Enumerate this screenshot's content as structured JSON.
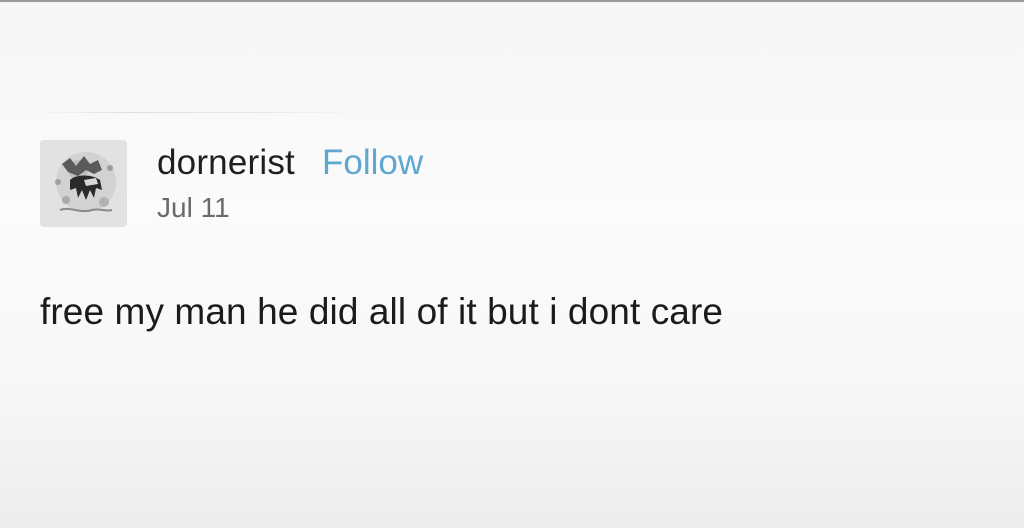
{
  "post": {
    "avatar_icon": "dark-creature-avatar",
    "username": "dornerist",
    "follow_label": "Follow",
    "date": "Jul 11",
    "text": "free my man he did all of it but i dont care"
  },
  "colors": {
    "follow": "#5ea7cf",
    "username": "#1f1f1f",
    "date": "#6a6a6a",
    "text": "#1b1b1b",
    "background": "#f8f8f8"
  }
}
